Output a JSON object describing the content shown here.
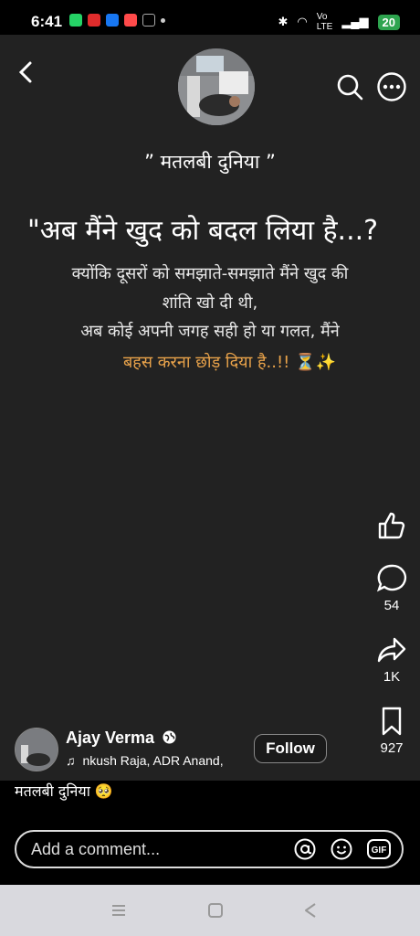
{
  "status_bar": {
    "time": "6:41",
    "battery": "20"
  },
  "post": {
    "brand": "” मतलबी दुनिया ”",
    "headline": "\"अब मैंने खुद को बदल लिया है...?",
    "lines": [
      "क्योंकि दूसरों को समझाते-समझाते मैंने खुद की",
      "शांति खो दी थी,",
      "अब कोई अपनी जगह सही हो या गलत, मैंने",
      "बहस करना छोड़ दिया है..!! ⏳✨"
    ]
  },
  "actions": {
    "comments": "54",
    "shares": "1K",
    "saves": "927"
  },
  "author": {
    "name": "Ajay Verma",
    "music": "nkush Raja, ADR Anand,",
    "follow_label": "Follow"
  },
  "caption": "मतलबी दुनिया 🥺",
  "comment": {
    "placeholder": "Add a comment..."
  },
  "colors": {
    "highlight": "#e8a24a",
    "battery": "#2ea44f"
  }
}
